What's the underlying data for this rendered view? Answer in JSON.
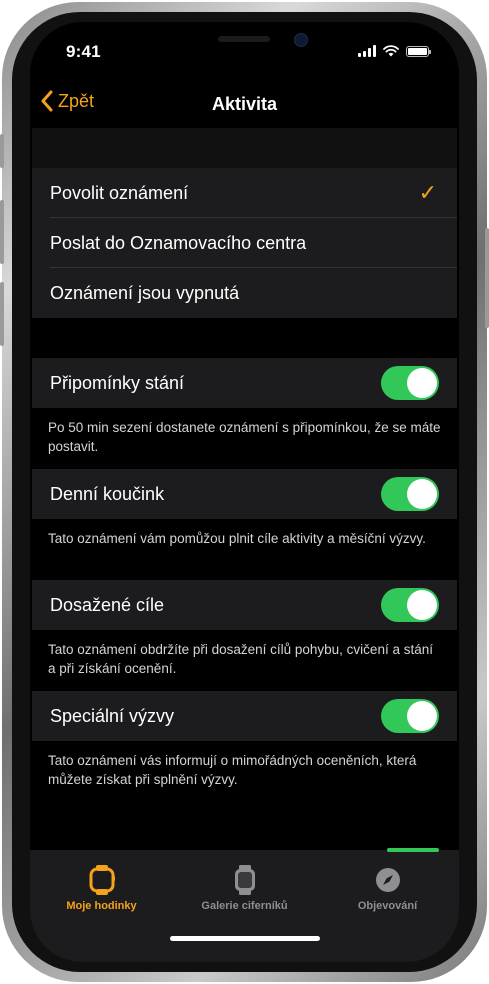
{
  "status_bar": {
    "time": "9:41"
  },
  "nav": {
    "back_label": "Zpět",
    "title": "Aktivita"
  },
  "notification_options": [
    {
      "label": "Povolit oznámení",
      "checked": true
    },
    {
      "label": "Poslat do Oznamovacího centra",
      "checked": false
    },
    {
      "label": "Oznámení jsou vypnutá",
      "checked": false
    }
  ],
  "settings": [
    {
      "label": "Připomínky stání",
      "enabled": true,
      "description": "Po 50 min sezení dostanete oznámení s připomínkou, že se máte postavit."
    },
    {
      "label": "Denní koučink",
      "enabled": true,
      "description": "Tato oznámení vám pomůžou plnit cíle aktivity a měsíční výzvy."
    },
    {
      "label": "Dosažené cíle",
      "enabled": true,
      "description": "Tato oznámení obdržíte při dosažení cílů pohybu, cvičení a stání a při získání ocenění."
    },
    {
      "label": "Speciální výzvy",
      "enabled": true,
      "description": "Tato oznámení vás informují o mimořádných oceněních, která můžete získat při splnění výzvy."
    }
  ],
  "tabs": [
    {
      "label": "Moje hodinky",
      "icon": "watch-icon",
      "active": true
    },
    {
      "label": "Galerie ciferníků",
      "icon": "watch-face-icon",
      "active": false
    },
    {
      "label": "Objevování",
      "icon": "compass-icon",
      "active": false
    }
  ],
  "colors": {
    "accent": "#f5a21b",
    "toggle_on": "#32c759",
    "background": "#000000",
    "cell": "#1c1c1e",
    "tab_inactive": "#8e8e93"
  }
}
